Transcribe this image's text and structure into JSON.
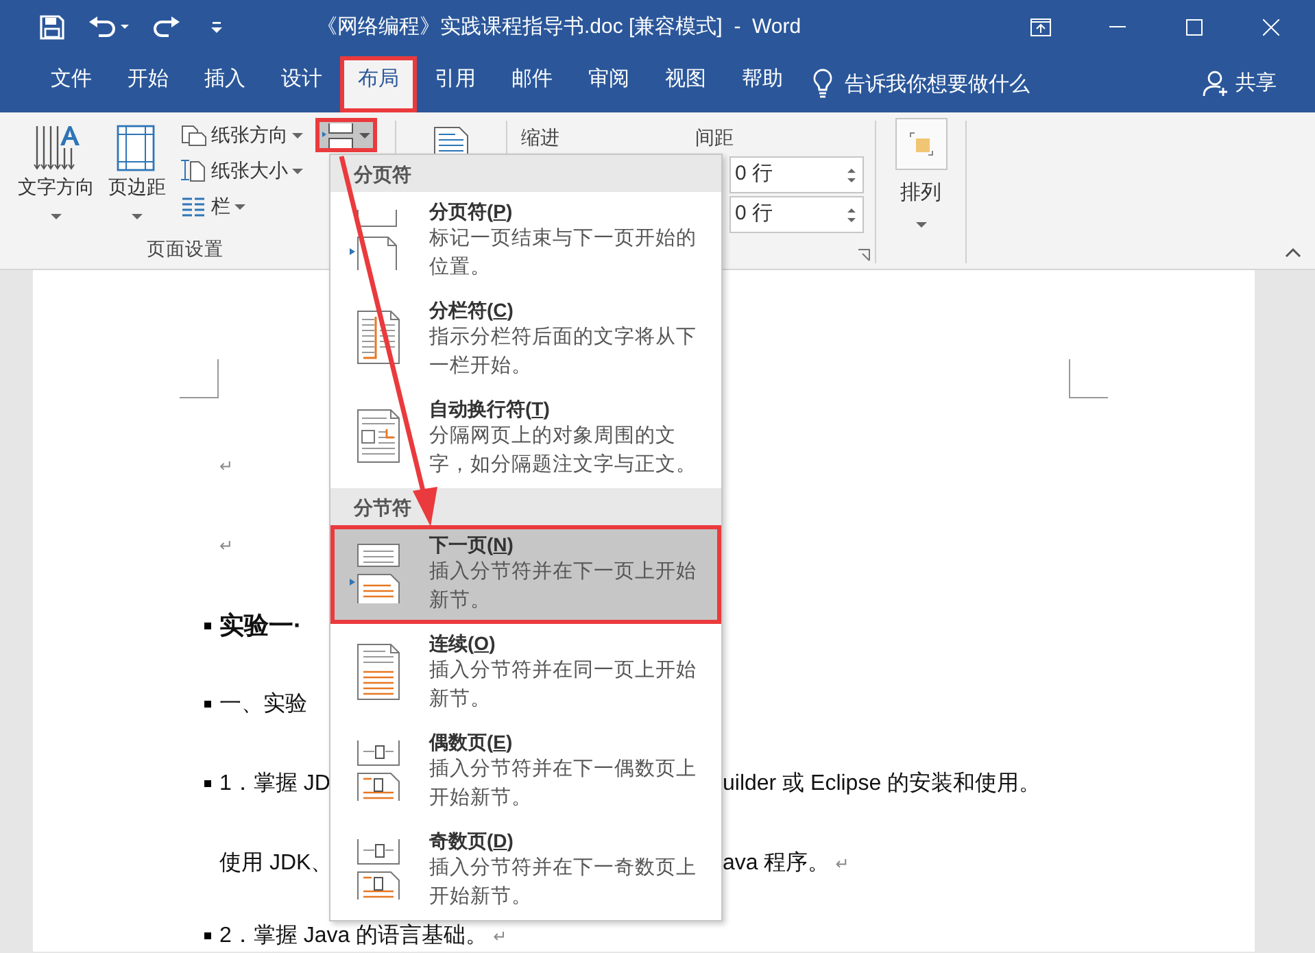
{
  "window": {
    "title": "《网络编程》实践课程指导书.doc [兼容模式]  -  Word"
  },
  "tabs": [
    {
      "label": "文件",
      "selected": false,
      "callout": false
    },
    {
      "label": "开始",
      "selected": false,
      "callout": false
    },
    {
      "label": "插入",
      "selected": false,
      "callout": false
    },
    {
      "label": "设计",
      "selected": false,
      "callout": false
    },
    {
      "label": "布局",
      "selected": true,
      "callout": true
    },
    {
      "label": "引用",
      "selected": false,
      "callout": false
    },
    {
      "label": "邮件",
      "selected": false,
      "callout": false
    },
    {
      "label": "审阅",
      "selected": false,
      "callout": false
    },
    {
      "label": "视图",
      "selected": false,
      "callout": false
    },
    {
      "label": "帮助",
      "selected": false,
      "callout": false
    }
  ],
  "tell_me": "告诉我你想要做什么",
  "share": "共享",
  "ribbon": {
    "page_setup": {
      "label": "页面设置",
      "large_buttons": [
        {
          "label": "文字方向",
          "kind": "text_direction"
        },
        {
          "label": "页边距",
          "kind": "margins"
        }
      ],
      "small_buttons": [
        {
          "label": "纸张方向",
          "kind": "orientation"
        },
        {
          "label": "纸张大小",
          "kind": "size"
        },
        {
          "label": "栏",
          "kind": "columns"
        }
      ],
      "breaks_button": {
        "pressed": true,
        "callout": true
      }
    },
    "paragraph": {
      "indent_label": "缩进",
      "spacing_label": "间距",
      "spacing_fields": [
        {
          "value": "0 行"
        },
        {
          "value": "0 行"
        }
      ]
    },
    "arrange": {
      "label": "排列"
    }
  },
  "break_menu": {
    "callout_arrow": true,
    "sections": [
      {
        "header": "分页符",
        "items": [
          {
            "kind": "page",
            "title": [
              "分页符(",
              "P",
              ")"
            ],
            "description": "标记一页结束与下一页开始的位置。",
            "selected": false,
            "callout": false
          },
          {
            "kind": "column",
            "title": [
              "分栏符(",
              "C",
              ")"
            ],
            "description": "指示分栏符后面的文字将从下一栏开始。",
            "selected": false,
            "callout": false
          },
          {
            "kind": "wrap",
            "title": [
              "自动换行符(",
              "T",
              ")"
            ],
            "description": "分隔网页上的对象周围的文字，如分隔题注文字与正文。",
            "selected": false,
            "callout": false
          }
        ]
      },
      {
        "header": "分节符",
        "items": [
          {
            "kind": "next",
            "title": [
              "下一页(",
              "N",
              ")"
            ],
            "description": "插入分节符并在下一页上开始新节。",
            "selected": true,
            "callout": true
          },
          {
            "kind": "continuous",
            "title": [
              "连续(",
              "O",
              ")"
            ],
            "description": "插入分节符并在同一页上开始新节。",
            "selected": false,
            "callout": false
          },
          {
            "kind": "even",
            "title": [
              "偶数页(",
              "E",
              ")"
            ],
            "description": "插入分节符并在下一偶数页上开始新节。",
            "selected": false,
            "callout": false
          },
          {
            "kind": "odd",
            "title": [
              "奇数页(",
              "D",
              ")"
            ],
            "description": "插入分节符并在下一奇数页上开始新节。",
            "selected": false,
            "callout": false
          }
        ]
      }
    ]
  },
  "document": {
    "lines": [
      {
        "kind": "blank",
        "mark": "↵"
      },
      {
        "kind": "blank",
        "mark": "↵"
      },
      {
        "kind": "heading",
        "bullet": true,
        "left": "实验一·"
      },
      {
        "kind": "body",
        "bullet": true,
        "left": "一、实验"
      },
      {
        "kind": "body",
        "bullet": true,
        "left": "1．掌握 JD",
        "right": "uilder 或 Eclipse 的安装和使用。"
      },
      {
        "kind": "body",
        "bullet": false,
        "left": "使用 JDK、",
        "right": "ava 程序。",
        "mark": "↵"
      },
      {
        "kind": "body",
        "bullet": true,
        "left": "2．掌握 Java 的语言基础。",
        "mark": "↵"
      }
    ]
  }
}
